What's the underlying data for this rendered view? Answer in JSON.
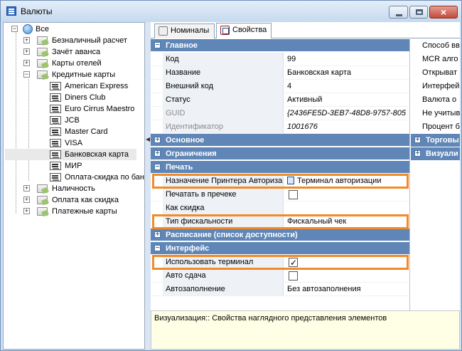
{
  "window": {
    "title": "Валюты",
    "minimize": "minimize",
    "maximize": "maximize",
    "close": "close"
  },
  "tree": {
    "root": "Все",
    "items": [
      "Безналичный расчет",
      "Зачёт аванса",
      "Карты отелей",
      "Кредитные карты"
    ],
    "credit_cards": [
      "American Express",
      "Diners Club",
      "Euro Cirrus Maestro",
      "JCB",
      "Master Card",
      "VISA",
      "Банковская карта",
      "МИР",
      "Оплата-скидка по бан"
    ],
    "after": [
      "Наличность",
      "Оплата как скидка",
      "Платежные карты"
    ]
  },
  "tabs": {
    "nominals": "Номиналы",
    "properties": "Свойства"
  },
  "properties": {
    "main": "Главное",
    "code": {
      "name": "Код",
      "value": "99"
    },
    "title_prop": {
      "name": "Название",
      "value": "Банковская карта"
    },
    "ext_code": {
      "name": "Внешний код",
      "value": "4"
    },
    "status": {
      "name": "Статус",
      "value": "Активный"
    },
    "guid": {
      "name": "GUID",
      "value": "{2436FE5D-3EB7-48D8-9757-805"
    },
    "id": {
      "name": "Идентификатор",
      "value": "1001676"
    },
    "basic": "Основное",
    "limits": "Ограничения",
    "print": "Печать",
    "printer": {
      "name": "Назначение Принтера Авторизации",
      "value": "Терминал авторизации"
    },
    "receipt": {
      "name": "Печатать в пречеке"
    },
    "as_discount": {
      "name": "Как скидка"
    },
    "fiscal": {
      "name": "Тип фискальности",
      "value": "Фискальный чек"
    },
    "schedule": "Расписание (список доступности)",
    "interface": "Интерфейс",
    "use_terminal": {
      "name": "Использовать терминал"
    },
    "auto_change": {
      "name": "Авто сдача"
    },
    "autofill": {
      "name": "Автозаполнение",
      "value": "Без автозаполнения"
    }
  },
  "side": {
    "rows": [
      "Способ вв",
      "MCR алго",
      "Открыват",
      "Интерфей",
      "Валюта о",
      "Не учитыв",
      "Процент б"
    ],
    "sections": [
      "Торговы",
      "Визуали"
    ]
  },
  "description": "Визуализация:: Свойства наглядного представления элементов",
  "colors": {
    "section": "#5f86b7",
    "highlight": "#f28a29"
  }
}
